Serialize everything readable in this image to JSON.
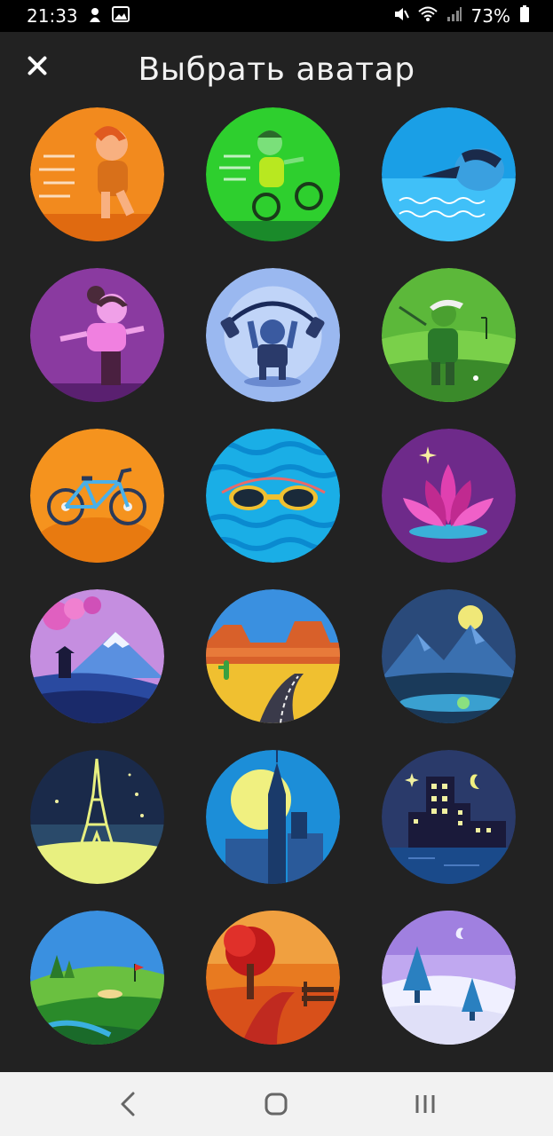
{
  "status_bar": {
    "time": "21:33",
    "battery": "73%",
    "icons": [
      "notification-icon",
      "gallery-icon",
      "mute-icon",
      "wifi-icon",
      "signal-icon",
      "battery-icon"
    ]
  },
  "header": {
    "title": "Выбрать аватар",
    "close_icon": "close-icon"
  },
  "avatars": [
    {
      "name": "runner",
      "bg": "#f28a1e"
    },
    {
      "name": "cyclist",
      "bg": "#2ecf2e"
    },
    {
      "name": "swimmer",
      "bg": "#1a9fe6"
    },
    {
      "name": "yoga",
      "bg": "#8a3aa0"
    },
    {
      "name": "weightlifter",
      "bg": "#9ab8f0"
    },
    {
      "name": "golfer",
      "bg": "#5cb83a"
    },
    {
      "name": "bicycle",
      "bg": "#f5931e"
    },
    {
      "name": "goggles",
      "bg": "#1aaee6"
    },
    {
      "name": "lotus",
      "bg": "#6e2a8a"
    },
    {
      "name": "mount-fuji",
      "bg": "#c58ee0"
    },
    {
      "name": "desert-road",
      "bg": "#f0a020"
    },
    {
      "name": "night-mountains",
      "bg": "#2a4a7a"
    },
    {
      "name": "eiffel-tower",
      "bg": "#1a2a4a"
    },
    {
      "name": "skyscraper",
      "bg": "#1c8ed8"
    },
    {
      "name": "night-city",
      "bg": "#2a3a6a"
    },
    {
      "name": "golf-course",
      "bg": "#3aa040"
    },
    {
      "name": "autumn-park",
      "bg": "#e87a20"
    },
    {
      "name": "winter-forest",
      "bg": "#c0a8f0"
    }
  ],
  "nav_bar": {
    "back_icon": "back-icon",
    "home_icon": "home-icon",
    "recents_icon": "recents-icon"
  }
}
